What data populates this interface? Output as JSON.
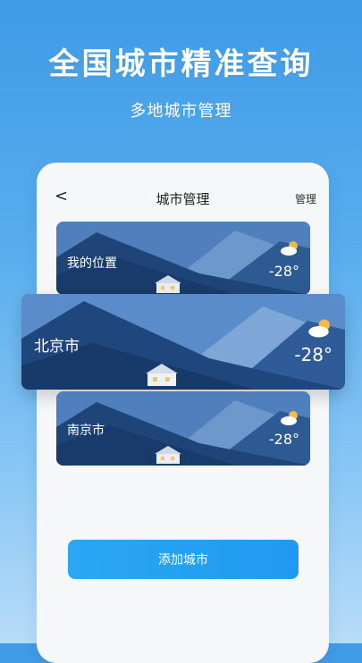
{
  "hero": {
    "headline": "全国城市精准查询",
    "subhead": "多地城市管理"
  },
  "nav": {
    "back_glyph": "<",
    "title": "城市管理",
    "manage_label": "管理"
  },
  "cities": [
    {
      "name": "我的位置",
      "temp": "-28°",
      "icon": "partly-cloudy-icon"
    },
    {
      "name": "北京市",
      "temp": "-28°",
      "icon": "partly-cloudy-icon"
    },
    {
      "name": "南京市",
      "temp": "-28°",
      "icon": "partly-cloudy-icon"
    }
  ],
  "add_button": "添加城市",
  "colors": {
    "background_top": "#3f9be6",
    "button": "#1f9af0",
    "card_dark": "#1c3f73",
    "card_light": "#5f8cc4"
  }
}
